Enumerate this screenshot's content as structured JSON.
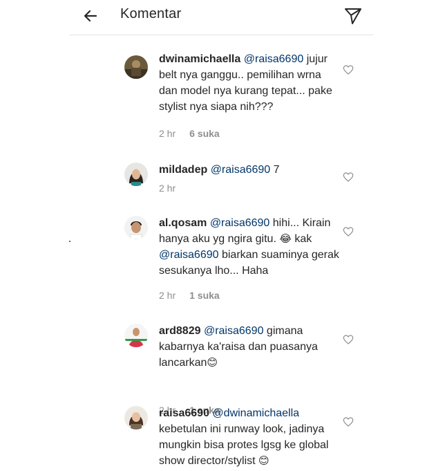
{
  "header": {
    "title": "Komentar",
    "back_icon": "arrow-left-icon",
    "send_icon": "paper-plane-icon"
  },
  "comments": [
    {
      "username": "dwinamichaella",
      "mention": "@raisa6690",
      "body": "jujur belt nya ganggu.. pemilihan wrna dan model nya kurang tepat... pake stylist nya siapa nih???",
      "time": "2 hr",
      "likes": "6 suka"
    },
    {
      "username": "mildadep",
      "mention": "@raisa6690",
      "body": "7",
      "time": "2 hr",
      "likes": ""
    },
    {
      "username": "al.qosam",
      "mention": "@raisa6690",
      "body_part1": "hihi... Kirain hanya aku yg ngira gitu.",
      "emoji": "😂",
      "body_part2": "kak",
      "mention2": "@raisa6690",
      "body_part3": "biarkan suaminya gerak sesukanya lho... Haha",
      "time": "2 hr",
      "likes": "1 suka"
    },
    {
      "username": "ard8829",
      "mention": "@raisa6690",
      "body": "gimana kabarnya ka'raisa dan puasanya lancarkan",
      "emoji": "😊",
      "time": "2 hr",
      "likes": "1 suka"
    },
    {
      "username": "raisa6690",
      "mention": "@dwinamichaella",
      "body": "kebetulan ini runway look, jadinya mungkin bisa protes lgsg ke global show director/stylist",
      "emoji": "😊",
      "time": "",
      "likes": ""
    }
  ],
  "icons": {
    "heart": "heart-outline-icon"
  }
}
